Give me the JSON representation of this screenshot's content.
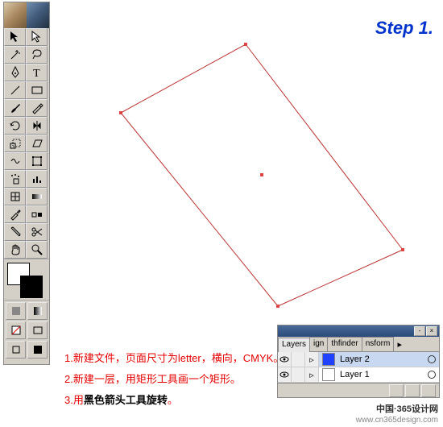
{
  "step_label": "Step 1.",
  "instructions": {
    "line1": "1.新建文件，页面尺寸为letter，横向，CMYK。",
    "line2_pre": "2.新建一层，用",
    "line2_key": "矩形工具画一个矩形",
    "line2_post": "。",
    "line3_pre": "3.用",
    "line3_key": "黑色箭头工具旋转",
    "line3_post": "。"
  },
  "layers_panel": {
    "tabs": [
      "Layers",
      "ign",
      "thfinder",
      "nsform"
    ],
    "active_tab": 0,
    "rows": [
      {
        "name": "Layer 2",
        "swatch": "#2040ff",
        "selected": true,
        "visible": true
      },
      {
        "name": "Layer 1",
        "swatch": "#ffffff",
        "selected": false,
        "visible": true
      }
    ]
  },
  "credit": {
    "site": "中国·365设计网",
    "url": "www.cn365design.com"
  },
  "tools": [
    "selection",
    "direct-selection",
    "magic-wand",
    "lasso",
    "pen",
    "type",
    "line",
    "rectangle",
    "brush",
    "rotate",
    "scale",
    "reflect",
    "distort",
    "free-transform",
    "symbol-sprayer",
    "graph",
    "mesh",
    "gradient",
    "eyedropper",
    "blend",
    "scissors",
    "knife",
    "hand",
    "zoom"
  ]
}
